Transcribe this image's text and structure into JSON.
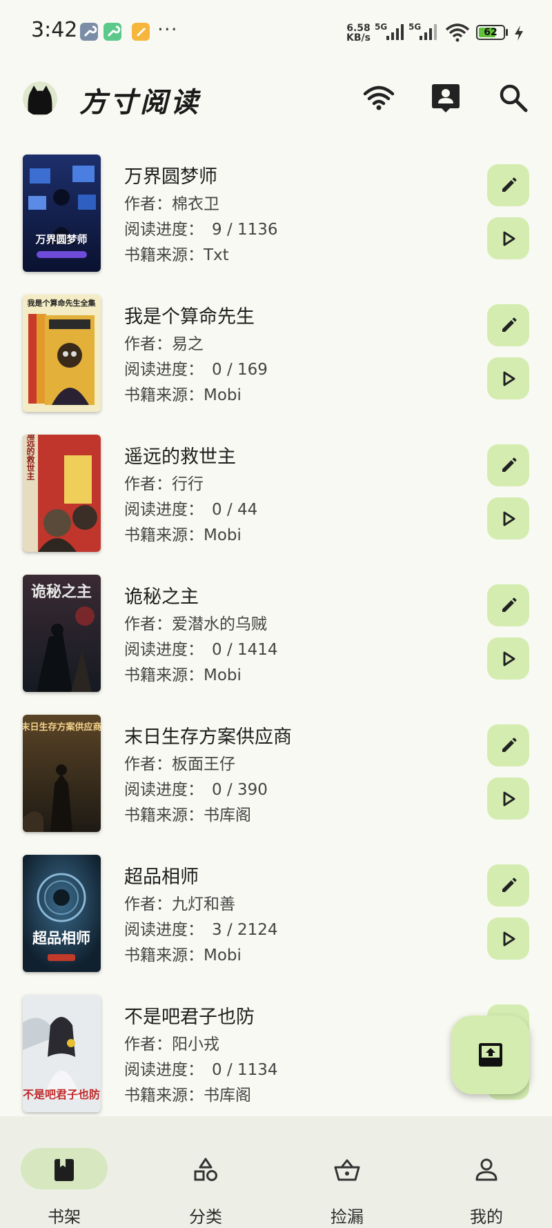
{
  "status_bar": {
    "time": "3:42",
    "more": "···",
    "speed_value": "6.58",
    "speed_unit": "KB/s",
    "network1": "5G",
    "network2": "5G",
    "battery": "62",
    "app_icon_colors": [
      "#7b8da6",
      "#5cc98a",
      "#f5b63b"
    ]
  },
  "app_bar": {
    "title": "方寸阅读",
    "icons": [
      "wifi-icon",
      "contacts-icon",
      "search-icon"
    ]
  },
  "books": [
    {
      "title": "万界圆梦师",
      "author_label": "作者：",
      "author": "棉衣卫",
      "progress_label": "阅读进度：",
      "progress": "9 / 1136",
      "source_label": "书籍来源：",
      "source": "Txt",
      "cover_text": "万界圆梦师"
    },
    {
      "title": "我是个算命先生",
      "author_label": "作者：",
      "author": "易之",
      "progress_label": "阅读进度：",
      "progress": "0 / 169",
      "source_label": "书籍来源：",
      "source": "Mobi",
      "cover_text": "我是个算命先生全集"
    },
    {
      "title": "遥远的救世主",
      "author_label": "作者：",
      "author": "行行",
      "progress_label": "阅读进度：",
      "progress": "0 / 44",
      "source_label": "书籍来源：",
      "source": "Mobi",
      "cover_text": "遥远的救世主"
    },
    {
      "title": "诡秘之主",
      "author_label": "作者：",
      "author": "爱潜水的乌贼",
      "progress_label": "阅读进度：",
      "progress": "0 / 1414",
      "source_label": "书籍来源：",
      "source": "Mobi",
      "cover_text": "诡秘之主"
    },
    {
      "title": "末日生存方案供应商",
      "author_label": "作者：",
      "author": "板面王仔",
      "progress_label": "阅读进度：",
      "progress": "0 / 390",
      "source_label": "书籍来源：",
      "source": "书库阁",
      "cover_text": "末日生存方案供应商"
    },
    {
      "title": "超品相师",
      "author_label": "作者：",
      "author": "九灯和善",
      "progress_label": "阅读进度：",
      "progress": "3 / 2124",
      "source_label": "书籍来源：",
      "source": "Mobi",
      "cover_text": "超品相师"
    },
    {
      "title": "不是吧君子也防",
      "author_label": "作者：",
      "author": "阳小戎",
      "progress_label": "阅读进度：",
      "progress": "0 / 1134",
      "source_label": "书籍来源：",
      "source": "书库阁",
      "cover_text": "不是吧君子也防"
    }
  ],
  "fab": {
    "icon": "import-book-icon"
  },
  "bottom_nav": [
    {
      "label": "书架",
      "icon": "book-icon",
      "active": true
    },
    {
      "label": "分类",
      "icon": "category-icon",
      "active": false
    },
    {
      "label": "捡漏",
      "icon": "basket-icon",
      "active": false
    },
    {
      "label": "我的",
      "icon": "person-icon",
      "active": false
    }
  ],
  "colors": {
    "background": "#f8f9f2",
    "button": "#d4ecb0",
    "nav_background": "#edefe6",
    "nav_active": "#d7e8c0"
  }
}
